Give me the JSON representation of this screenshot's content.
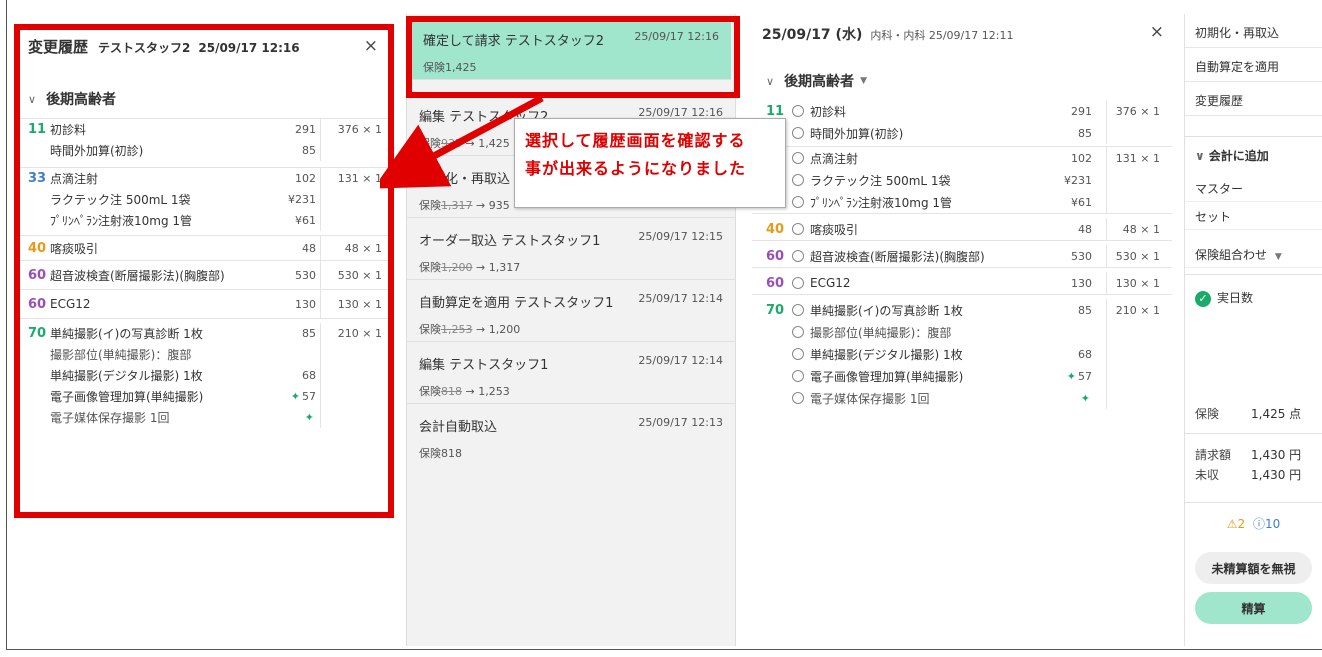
{
  "history_panel": {
    "title": "変更履歴",
    "staff": "テストスタッフ2",
    "time": "25/09/17 12:16",
    "close": "×",
    "category": "後期高齢者",
    "groups": [
      {
        "code": "11",
        "rows": [
          {
            "name": "初診料",
            "value": "291",
            "qty": "376 × 1"
          },
          {
            "name": "時間外加算(初診)",
            "value": "85",
            "qty": ""
          }
        ]
      },
      {
        "code": "33",
        "rows": [
          {
            "name": "点滴注射",
            "value": "102",
            "qty": "131 × 1"
          },
          {
            "name": "ラクテック注 500mL 1袋",
            "value": "¥231",
            "qty": ""
          },
          {
            "name": "ﾌﾟﾘﾝﾍﾟﾗﾝ注射液10mg 1管",
            "value": "¥61",
            "qty": ""
          }
        ]
      },
      {
        "code": "40",
        "rows": [
          {
            "name": "喀痰吸引",
            "value": "48",
            "qty": "48 × 1"
          }
        ]
      },
      {
        "code": "60",
        "rows": [
          {
            "name": "超音波検査(断層撮影法)(胸腹部)",
            "value": "530",
            "qty": "530 × 1"
          }
        ]
      },
      {
        "code": "60",
        "rows": [
          {
            "name": "ECG12",
            "value": "130",
            "qty": "130 × 1"
          }
        ]
      },
      {
        "code": "70",
        "rows": [
          {
            "name": "単純撮影(イ)の写真診断 1枚",
            "value": "85",
            "qty": "210 × 1"
          },
          {
            "name": "撮影部位(単純撮影)：腹部",
            "value": "",
            "qty": ""
          },
          {
            "name": "単純撮影(デジタル撮影) 1枚",
            "value": "68",
            "qty": ""
          },
          {
            "name": "電子画像管理加算(単純撮影)",
            "value": "57",
            "qty": ""
          },
          {
            "name": "電子媒体保存撮影 1回",
            "value": "",
            "qty": ""
          }
        ]
      }
    ]
  },
  "history_list": [
    {
      "action": "確定して請求",
      "staff": "テストスタッフ2",
      "time": "25/09/17 12:16",
      "prefix": "保険",
      "old": "",
      "new": "1,425"
    },
    {
      "action": "編集",
      "staff": "テストスタッフ2",
      "time": "25/09/17 12:16",
      "prefix": "保険",
      "old": "935",
      "new": "1,425"
    },
    {
      "action": "初期化・再取込",
      "staff": "",
      "time": "",
      "prefix": "保険",
      "old": "1,317",
      "new": "935"
    },
    {
      "action": "オーダー取込",
      "staff": "テストスタッフ1",
      "time": "25/09/17 12:15",
      "prefix": "保険",
      "old": "1,200",
      "new": "1,317"
    },
    {
      "action": "自動算定を適用",
      "staff": "テストスタッフ1",
      "time": "25/09/17 12:14",
      "prefix": "保険",
      "old": "1,253",
      "new": "1,200"
    },
    {
      "action": "編集",
      "staff": "テストスタッフ1",
      "time": "25/09/17 12:14",
      "prefix": "保険",
      "old": "818",
      "new": "1,253"
    },
    {
      "action": "会計自動取込",
      "staff": "",
      "time": "25/09/17 12:13",
      "prefix": "保険",
      "old": "",
      "new": "818"
    }
  ],
  "callout": {
    "line1": "選択して履歴画面を確認する",
    "line2": "事が出来るようになりました"
  },
  "main_panel": {
    "date": "25/09/17 (水)",
    "dept": "内科・内科 25/09/17 12:11",
    "close": "×",
    "category": "後期高齢者",
    "groups": [
      {
        "code": "11",
        "rows": [
          {
            "name": "初診料",
            "value": "291",
            "qty": "376 × 1"
          },
          {
            "name": "時間外加算(初診)",
            "value": "85",
            "qty": ""
          }
        ]
      },
      {
        "code": "",
        "rows": [
          {
            "name": "点滴注射",
            "value": "102",
            "qty": "131 × 1"
          },
          {
            "name": "ラクテック注 500mL 1袋",
            "value": "¥231",
            "qty": ""
          },
          {
            "name": "ﾌﾟﾘﾝﾍﾟﾗﾝ注射液10mg 1管",
            "value": "¥61",
            "qty": ""
          }
        ]
      },
      {
        "code": "40",
        "rows": [
          {
            "name": "喀痰吸引",
            "value": "48",
            "qty": "48 × 1"
          }
        ]
      },
      {
        "code": "60",
        "rows": [
          {
            "name": "超音波検査(断層撮影法)(胸腹部)",
            "value": "530",
            "qty": "530 × 1"
          }
        ]
      },
      {
        "code": "60",
        "rows": [
          {
            "name": "ECG12",
            "value": "130",
            "qty": "130 × 1"
          }
        ]
      },
      {
        "code": "70",
        "rows": [
          {
            "name": "単純撮影(イ)の写真診断 1枚",
            "value": "85",
            "qty": "210 × 1"
          },
          {
            "name": "撮影部位(単純撮影)：腹部",
            "value": "",
            "qty": ""
          },
          {
            "name": "単純撮影(デジタル撮影) 1枚",
            "value": "68",
            "qty": ""
          },
          {
            "name": "電子画像管理加算(単純撮影)",
            "value": "57",
            "qty": ""
          },
          {
            "name": "電子媒体保存撮影 1回",
            "value": "",
            "qty": ""
          }
        ]
      }
    ]
  },
  "sidebar": {
    "btn_reset": "初期化・再取込",
    "btn_auto": "自動算定を適用",
    "btn_history": "変更履歴",
    "section_add": "会計に追加",
    "item_master": "マスター",
    "item_set": "セット",
    "item_combo": "保険組合わせ",
    "days_label": "実日数",
    "insurance_label": "保険",
    "insurance_value": "1,425 点",
    "billed_label": "請求額",
    "billed_value": "1,430 円",
    "unpaid_label": "未収",
    "unpaid_value": "1,430 円",
    "warn_count": "2",
    "info_count": "10",
    "ignore_btn": "未精算額を無視",
    "settle_btn": "精算"
  },
  "colors": {
    "accent_green": "#1aab6a",
    "highlight": "#9fe6cd",
    "annotation_red": "#e00000"
  }
}
